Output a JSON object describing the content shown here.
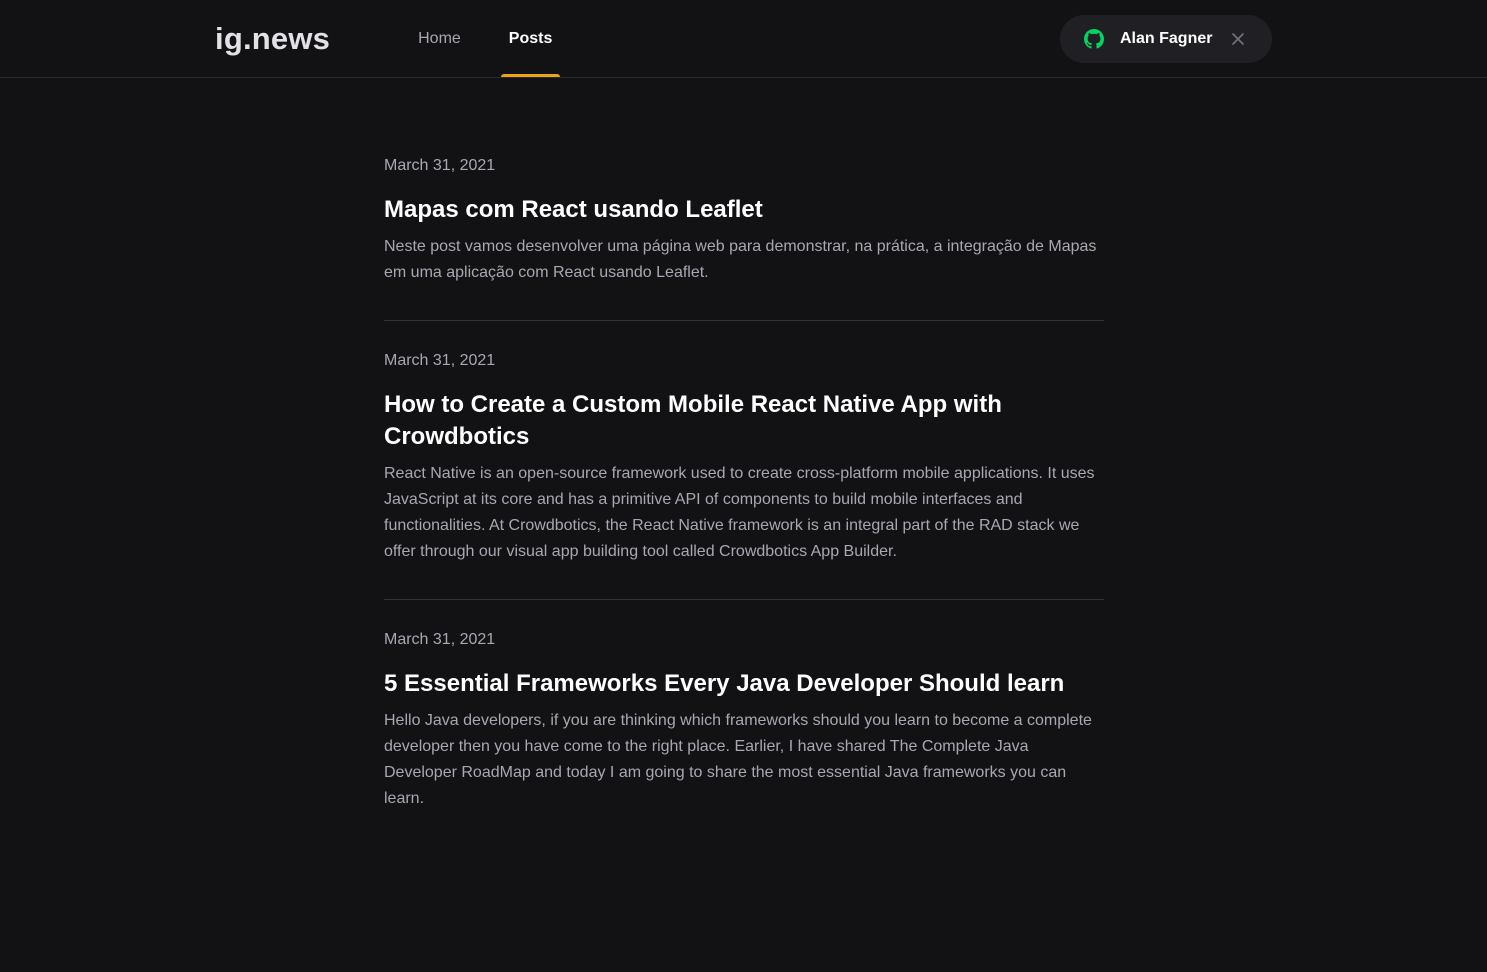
{
  "header": {
    "logo_main": "ig",
    "logo_suffix": ".news",
    "nav": [
      {
        "label": "Home",
        "active": false
      },
      {
        "label": "Posts",
        "active": true
      }
    ],
    "signin": {
      "user_name": "Alan Fagner",
      "icon": "github-icon",
      "close_icon": "close-icon"
    }
  },
  "colors": {
    "background": "#121214",
    "accent": "#eba417",
    "github_green": "#04d361",
    "text_muted": "#a8a8b3"
  },
  "posts": [
    {
      "date": "March 31, 2021",
      "title": "Mapas com React usando Leaflet",
      "excerpt": "Neste post vamos desenvolver uma página web para demonstrar, na prática, a integração de Mapas em uma aplicação com React usando Leaflet."
    },
    {
      "date": "March 31, 2021",
      "title": "How to Create a Custom Mobile React Native App with Crowdbotics",
      "excerpt": "React Native is an open-source framework used to create cross-platform mobile applications. It uses JavaScript at its core and has a primitive API of components to build mobile interfaces and functionalities. At Crowdbotics, the React Native framework is an integral part of the RAD stack we offer through our visual app building tool called Crowdbotics App Builder."
    },
    {
      "date": "March 31, 2021",
      "title": "5 Essential Frameworks Every Java Developer Should learn",
      "excerpt": "Hello Java developers, if you are thinking which frameworks should you learn to become a complete developer then you have come to the right place. Earlier, I have shared The Complete Java Developer RoadMap and today I am going to share the most essential Java frameworks you can learn."
    }
  ]
}
